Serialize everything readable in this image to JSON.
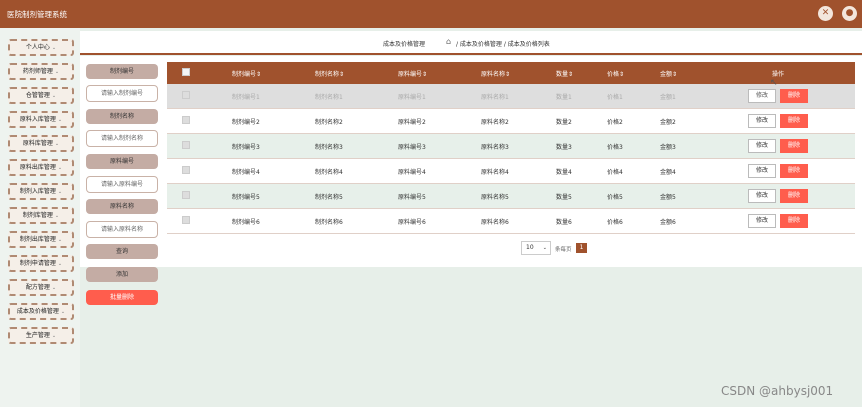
{
  "app": {
    "title": "医院制剂管理系统"
  },
  "icons": {
    "fullscreen": "fullscreen-icon",
    "user": "user-icon",
    "home": "home-icon"
  },
  "sidebar": {
    "items": [
      {
        "label": "个人中心"
      },
      {
        "label": "药剂师管理"
      },
      {
        "label": "仓管管理"
      },
      {
        "label": "原料入库管理"
      },
      {
        "label": "原料库管理"
      },
      {
        "label": "原料出库管理"
      },
      {
        "label": "制剂入库管理"
      },
      {
        "label": "制剂库管理"
      },
      {
        "label": "制剂出库管理"
      },
      {
        "label": "制剂申请管理"
      },
      {
        "label": "配方管理"
      },
      {
        "label": "成本及价格管理"
      },
      {
        "label": "生产管理"
      }
    ]
  },
  "breadcrumb": {
    "page": "成本及价格管理",
    "path": "/ 成本及价格管理 / 成本及价格列表"
  },
  "search": {
    "prep_no_label": "制剂编号",
    "prep_no_placeholder": "请输入制剂编号",
    "prep_name_label": "制剂名称",
    "prep_name_placeholder": "请输入制剂名称",
    "mat_no_label": "原料编号",
    "mat_no_placeholder": "请输入原料编号",
    "mat_name_label": "原料名称",
    "mat_name_placeholder": "请输入原料名称",
    "query_label": "查询",
    "add_label": "添加",
    "batch_delete_label": "批量删除"
  },
  "table": {
    "headers": [
      "制剂编号",
      "制剂名称",
      "原料编号",
      "原料名称",
      "数量",
      "价格",
      "金额",
      "操作"
    ],
    "edit_label": "修改",
    "delete_label": "删除",
    "rows": [
      [
        "制剂编号1",
        "制剂名称1",
        "原料编号1",
        "原料名称1",
        "数量1",
        "价格1",
        "金额1"
      ],
      [
        "制剂编号2",
        "制剂名称2",
        "原料编号2",
        "原料名称2",
        "数量2",
        "价格2",
        "金额2"
      ],
      [
        "制剂编号3",
        "制剂名称3",
        "原料编号3",
        "原料名称3",
        "数量3",
        "价格3",
        "金额3"
      ],
      [
        "制剂编号4",
        "制剂名称4",
        "原料编号4",
        "原料名称4",
        "数量4",
        "价格4",
        "金额4"
      ],
      [
        "制剂编号5",
        "制剂名称5",
        "原料编号5",
        "原料名称5",
        "数量5",
        "价格5",
        "金额5"
      ],
      [
        "制剂编号6",
        "制剂名称6",
        "原料编号6",
        "原料名称6",
        "数量6",
        "价格6",
        "金额6"
      ]
    ]
  },
  "pager": {
    "page_size": "10",
    "per_page_text": "条每页",
    "current_page": "1"
  },
  "watermark": "CSDN @ahbysj001",
  "colors": {
    "brand": "#a0522d",
    "danger": "#ff5d4d",
    "label": "#c4aca4"
  }
}
